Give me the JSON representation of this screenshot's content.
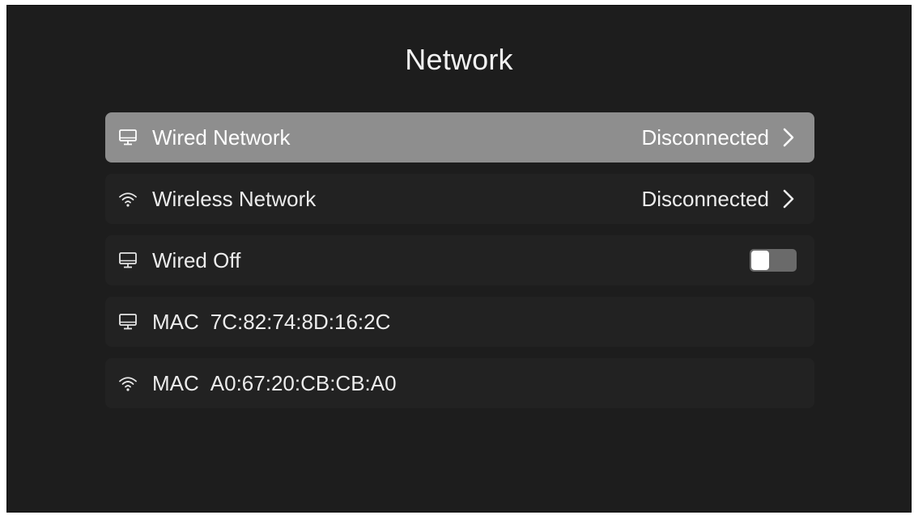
{
  "title": "Network",
  "rows": [
    {
      "label": "Wired Network",
      "value": "Disconnected",
      "icon": "monitor-icon",
      "focused": true
    },
    {
      "label": "Wireless Network",
      "value": "Disconnected",
      "icon": "wifi-icon",
      "focused": false
    },
    {
      "label": "Wired Off",
      "toggle_on": false,
      "icon": "monitor-icon"
    },
    {
      "key": "MAC",
      "value": "7C:82:74:8D:16:2C",
      "icon": "monitor-icon"
    },
    {
      "key": "MAC",
      "value": "A0:67:20:CB:CB:A0",
      "icon": "wifi-icon"
    }
  ],
  "colors": {
    "background": "#1d1d1d",
    "row": "#222222",
    "focused_row": "#8e8e8e",
    "text": "#ececec"
  }
}
